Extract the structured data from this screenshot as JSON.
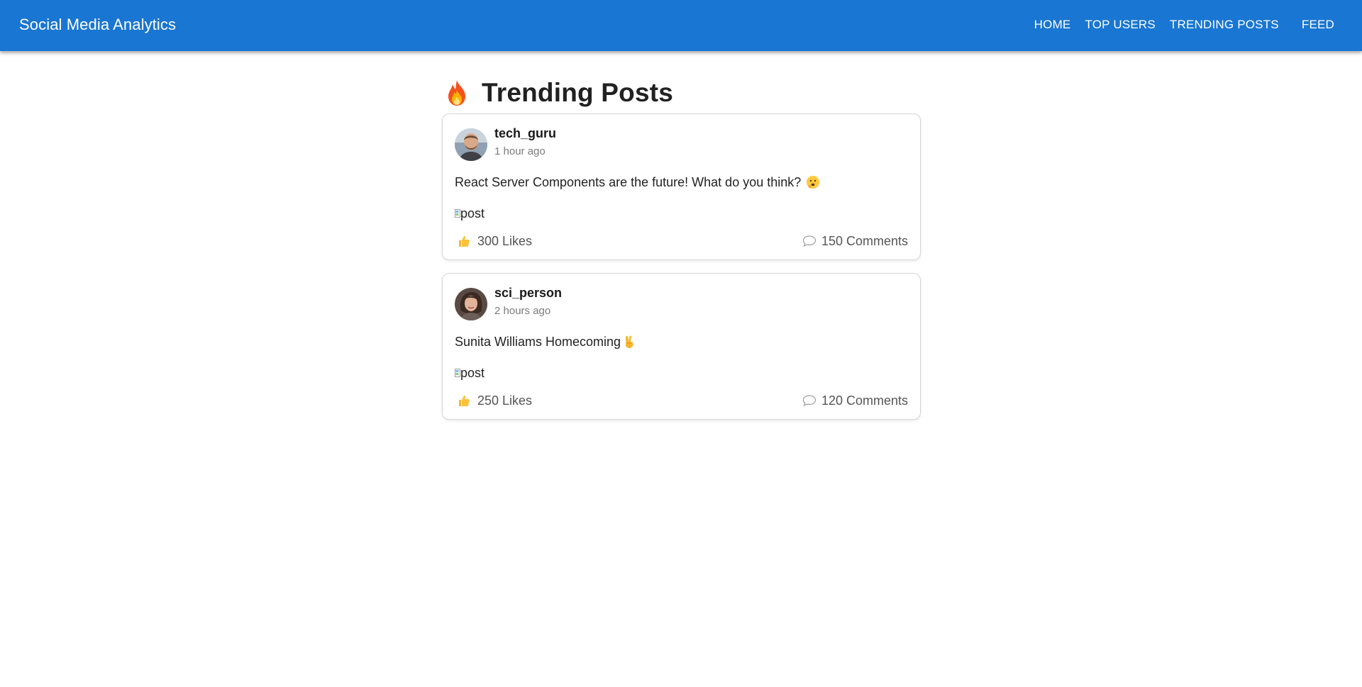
{
  "app": {
    "title": "Social Media Analytics"
  },
  "nav": {
    "items": [
      "HOME",
      "TOP USERS",
      "TRENDING POSTS",
      "FEED"
    ]
  },
  "page": {
    "title": "Trending Posts",
    "title_icon": "flame-icon"
  },
  "posts": [
    {
      "username": "tech_guru",
      "time": "1 hour ago",
      "text": "React Server Components are the future! What do you think?",
      "emoji": "thinking-face-icon",
      "image_alt": "post",
      "likes": "300 Likes",
      "comments": "150 Comments"
    },
    {
      "username": "sci_person",
      "time": "2 hours ago",
      "text": "Sunita Williams Homecoming",
      "emoji": "victory-hand-icon",
      "image_alt": "post",
      "likes": "250 Likes",
      "comments": "120 Comments"
    }
  ],
  "colors": {
    "appbar": "#1976d2",
    "card_border": "#d6d6d6",
    "muted_text": "#7a7a7a"
  }
}
